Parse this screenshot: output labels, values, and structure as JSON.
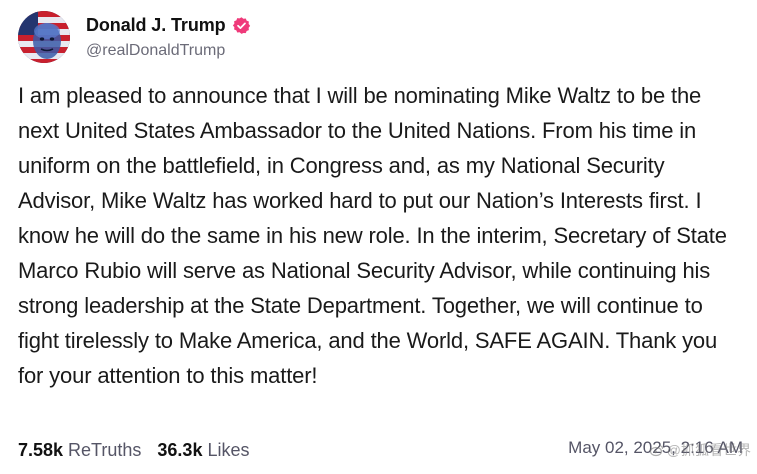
{
  "author": {
    "display_name": "Donald J. Trump",
    "handle": "@realDonaldTrump",
    "verified_color": "#ef3a7a"
  },
  "post": {
    "text": "I am pleased to announce that I will be nominating Mike Waltz to be the next United States Ambassador to the United Nations. From his time in uniform on the battlefield, in Congress and, as my National Security Advisor, Mike Waltz has worked hard to put our Nation’s Interests first. I know he will do the same in his new role. In the interim, Secretary of State Marco Rubio will serve as National Security Advisor, while continuing his strong leadership at the State Department. Together, we will continue to fight tirelessly to Make America, and the World, SAFE AGAIN. Thank you for your attention to this matter!"
  },
  "stats": {
    "retruths_count": "7.58k",
    "retruths_label": "ReTruths",
    "likes_count": "36.3k",
    "likes_label": "Likes"
  },
  "timestamp": "May 02, 2025, 2:16 AM",
  "watermark": {
    "icon": "weibo-icon",
    "text": "@抓狐看世界"
  }
}
